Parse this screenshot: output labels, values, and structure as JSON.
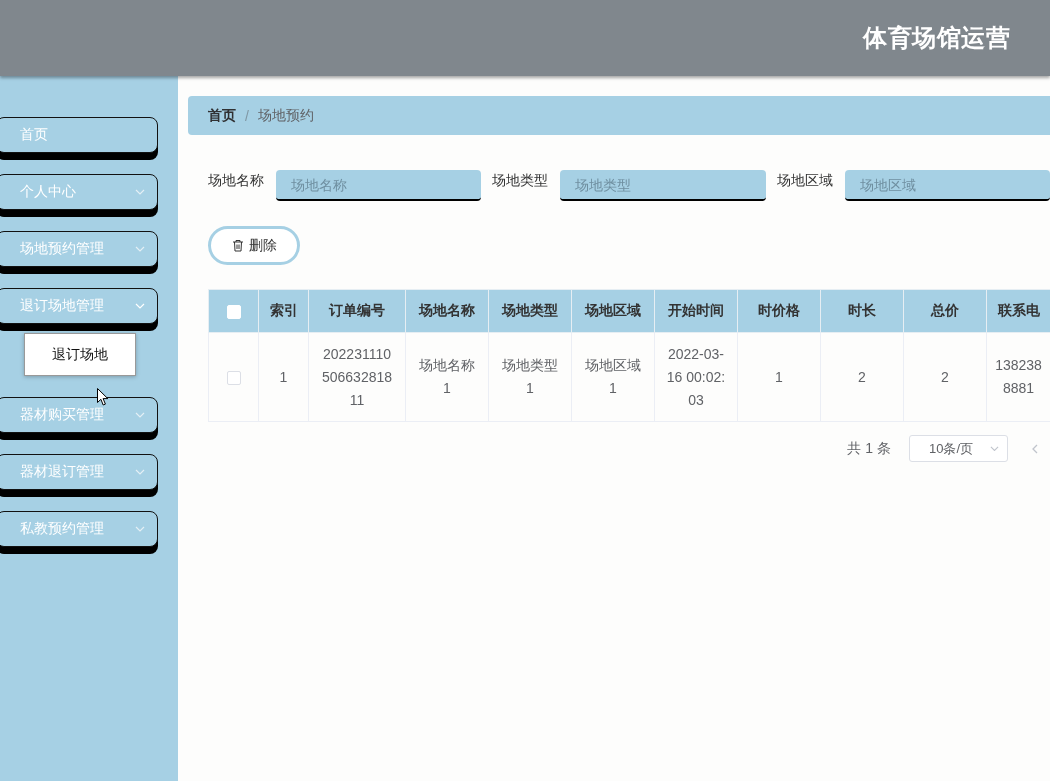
{
  "header": {
    "title": "体育场馆运营"
  },
  "sidebar": {
    "items": [
      {
        "label": "首页",
        "kind": "link"
      },
      {
        "label": "个人中心",
        "kind": "submenu",
        "expanded": false
      },
      {
        "label": "场地预约管理",
        "kind": "submenu",
        "expanded": false
      },
      {
        "label": "退订场地管理",
        "kind": "submenu",
        "expanded": true,
        "children": [
          {
            "label": "退订场地"
          }
        ]
      },
      {
        "label": "器材购买管理",
        "kind": "submenu",
        "expanded": false
      },
      {
        "label": "器材退订管理",
        "kind": "submenu",
        "expanded": false
      },
      {
        "label": "私教预约管理",
        "kind": "submenu",
        "expanded": false
      }
    ]
  },
  "breadcrumb": {
    "separator": "/",
    "items": [
      {
        "label": "首页",
        "kind": "link"
      },
      {
        "label": "场地预约",
        "kind": "current"
      }
    ]
  },
  "search": {
    "fields": [
      {
        "label": "场地名称",
        "placeholder": "场地名称"
      },
      {
        "label": "场地类型",
        "placeholder": "场地类型"
      },
      {
        "label": "场地区域",
        "placeholder": "场地区域"
      }
    ]
  },
  "actions": [
    {
      "label": "删除",
      "kind": "delete"
    }
  ],
  "table": {
    "columns": [
      {
        "kind": "checkbox",
        "checked": false
      },
      {
        "kind": "text",
        "label": "索引"
      },
      {
        "kind": "text",
        "label": "订单编号"
      },
      {
        "kind": "text",
        "label": "场地名称"
      },
      {
        "kind": "text",
        "label": "场地类型"
      },
      {
        "kind": "text",
        "label": "场地区域"
      },
      {
        "kind": "text",
        "label": "开始时间"
      },
      {
        "kind": "text",
        "label": "时价格"
      },
      {
        "kind": "text",
        "label": "时长"
      },
      {
        "kind": "text",
        "label": "总价"
      },
      {
        "kind": "text",
        "label": "联系电"
      }
    ],
    "rows": [
      {
        "cells": [
          {
            "kind": "checkbox",
            "checked": false
          },
          {
            "kind": "text",
            "text": "1"
          },
          {
            "kind": "text",
            "text": "20223111050663281811"
          },
          {
            "kind": "text",
            "text": "场地名称1"
          },
          {
            "kind": "text",
            "text": "场地类型1"
          },
          {
            "kind": "text",
            "text": "场地区域1"
          },
          {
            "kind": "text",
            "text": "2022-03-16 00:02:03"
          },
          {
            "kind": "text",
            "text": "1"
          },
          {
            "kind": "text",
            "text": "2"
          },
          {
            "kind": "text",
            "text": "2"
          },
          {
            "kind": "lines",
            "lines": [
              "138238",
              "8881"
            ]
          }
        ]
      }
    ]
  },
  "pagination": {
    "total": "共 1 条",
    "page_size": "10条/页"
  }
}
